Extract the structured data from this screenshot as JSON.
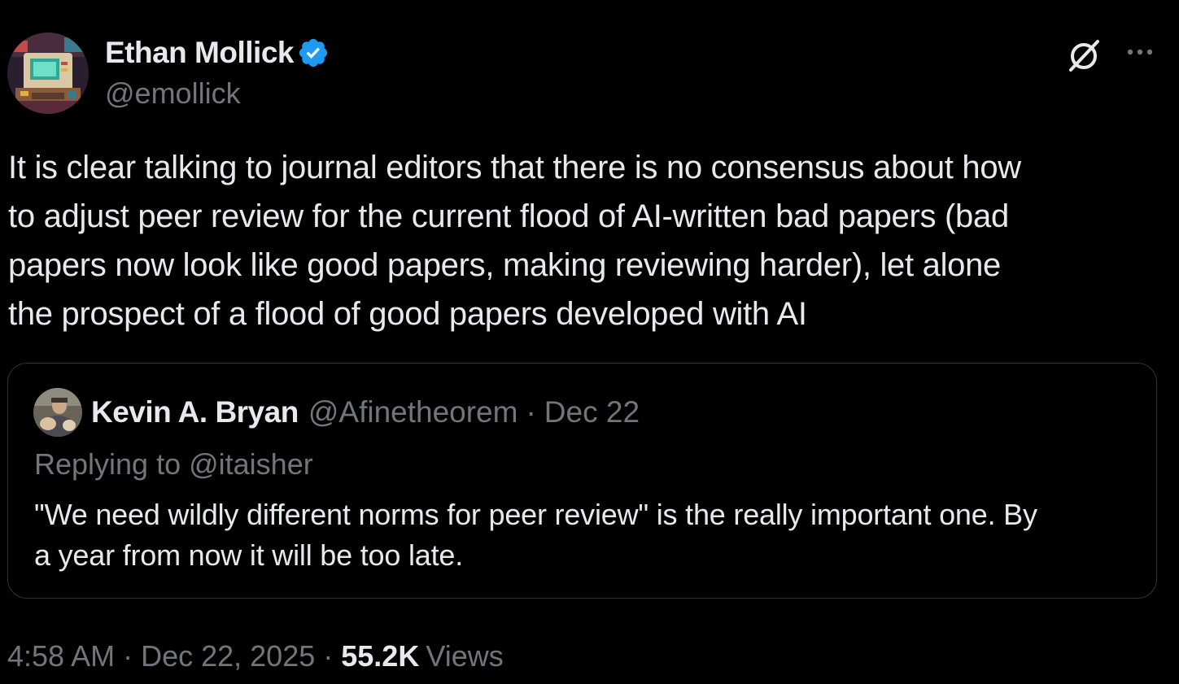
{
  "tweet": {
    "author": {
      "name": "Ethan Mollick",
      "handle": "@emollick",
      "verified_color": "#1d9bf0",
      "avatar_icon": "avatar-pixel-art-computer"
    },
    "actions": {
      "grok_icon": "grok-icon",
      "more_icon": "more-horizontal-icon"
    },
    "text_lines": [
      "It is clear talking to journal editors that there is no consensus about how",
      "to adjust peer review for the current flood of AI-written bad papers (bad",
      "papers now look like good papers, making reviewing harder), let alone",
      "the prospect of a flood of good papers developed with AI"
    ],
    "quote": {
      "name": "Kevin A. Bryan",
      "handle": "@Afinetheorem",
      "separator": "·",
      "date": "Dec 22",
      "replying_to": "Replying to @itaisher",
      "text_lines": [
        "\"We need wildly different norms for peer review\" is the really important one. By",
        "a year from now it will be too late."
      ]
    },
    "meta": {
      "time": "4:58 AM",
      "separator": "·",
      "date": "Dec 22, 2025",
      "views_count": "55.2K",
      "views_label": "Views"
    }
  },
  "colors": {
    "background": "#000000",
    "primary_text": "#e7e9ea",
    "secondary_text": "#71767b",
    "border": "#2f3336",
    "accent": "#1d9bf0"
  }
}
